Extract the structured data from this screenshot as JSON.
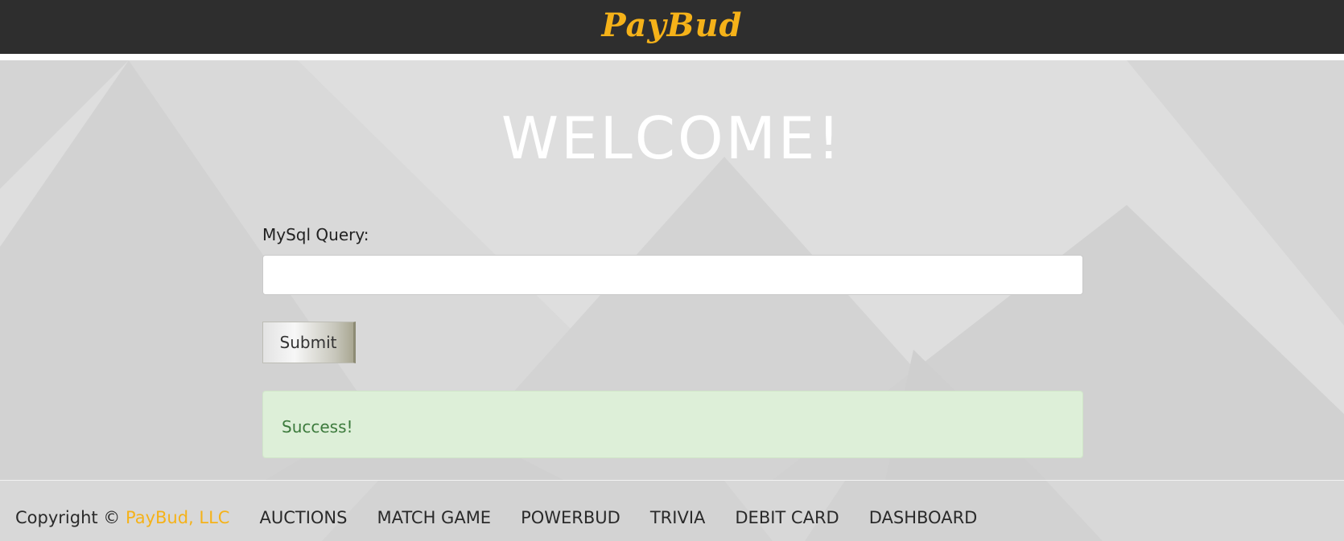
{
  "header": {
    "logo": "PayBud",
    "logo_color": "#f5b219",
    "background": "#2e2e2e"
  },
  "main": {
    "title": "WELCOME!",
    "form": {
      "label": "MySql Query:",
      "input_value": "",
      "input_placeholder": "",
      "submit_label": "Submit"
    },
    "alert": {
      "text": "Success!",
      "background": "#ddefd8",
      "color": "#3c7a3c"
    }
  },
  "footer": {
    "copyright_prefix": "Copyright ©",
    "copyright_brand": "PayBud, LLC",
    "nav": [
      "AUCTIONS",
      "MATCH GAME",
      "POWERBUD",
      "TRIVIA",
      "DEBIT CARD",
      "DASHBOARD"
    ]
  }
}
